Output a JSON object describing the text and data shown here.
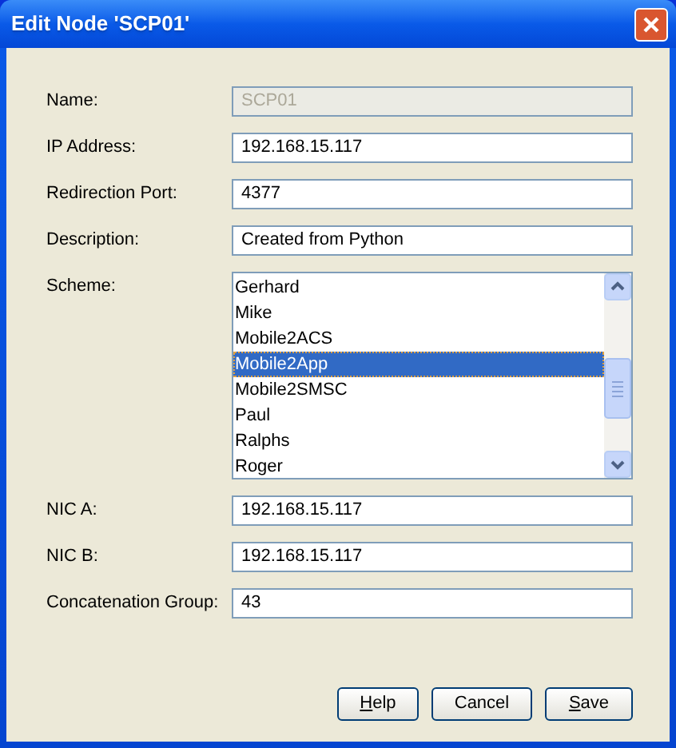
{
  "window": {
    "title": "Edit Node 'SCP01'"
  },
  "fields": [
    {
      "kind": "text",
      "label": "Name:",
      "value": "SCP01",
      "disabled": true
    },
    {
      "kind": "text",
      "label": "IP Address:",
      "value": "192.168.15.117",
      "disabled": false
    },
    {
      "kind": "text",
      "label": "Redirection Port:",
      "value": "4377",
      "disabled": false
    },
    {
      "kind": "text",
      "label": "Description:",
      "value": "Created from Python",
      "disabled": false
    },
    {
      "kind": "list",
      "label": "Scheme:",
      "items": [
        {
          "label": "Gerhard",
          "selected": false
        },
        {
          "label": "Mike",
          "selected": false
        },
        {
          "label": "Mobile2ACS",
          "selected": false
        },
        {
          "label": "Mobile2App",
          "selected": true
        },
        {
          "label": "Mobile2SMSC",
          "selected": false
        },
        {
          "label": "Paul",
          "selected": false
        },
        {
          "label": "Ralphs",
          "selected": false
        },
        {
          "label": "Roger",
          "selected": false
        }
      ]
    },
    {
      "kind": "text",
      "label": "NIC A:",
      "value": "192.168.15.117",
      "disabled": false
    },
    {
      "kind": "text",
      "label": "NIC B:",
      "value": "192.168.15.117",
      "disabled": false
    },
    {
      "kind": "text",
      "label": "Concatenation Group:",
      "value": "43",
      "disabled": false
    }
  ],
  "buttons": [
    {
      "label": "Help",
      "mnemonic_first": true
    },
    {
      "label": "Cancel",
      "mnemonic_first": false
    },
    {
      "label": "Save",
      "mnemonic_first": true
    }
  ]
}
